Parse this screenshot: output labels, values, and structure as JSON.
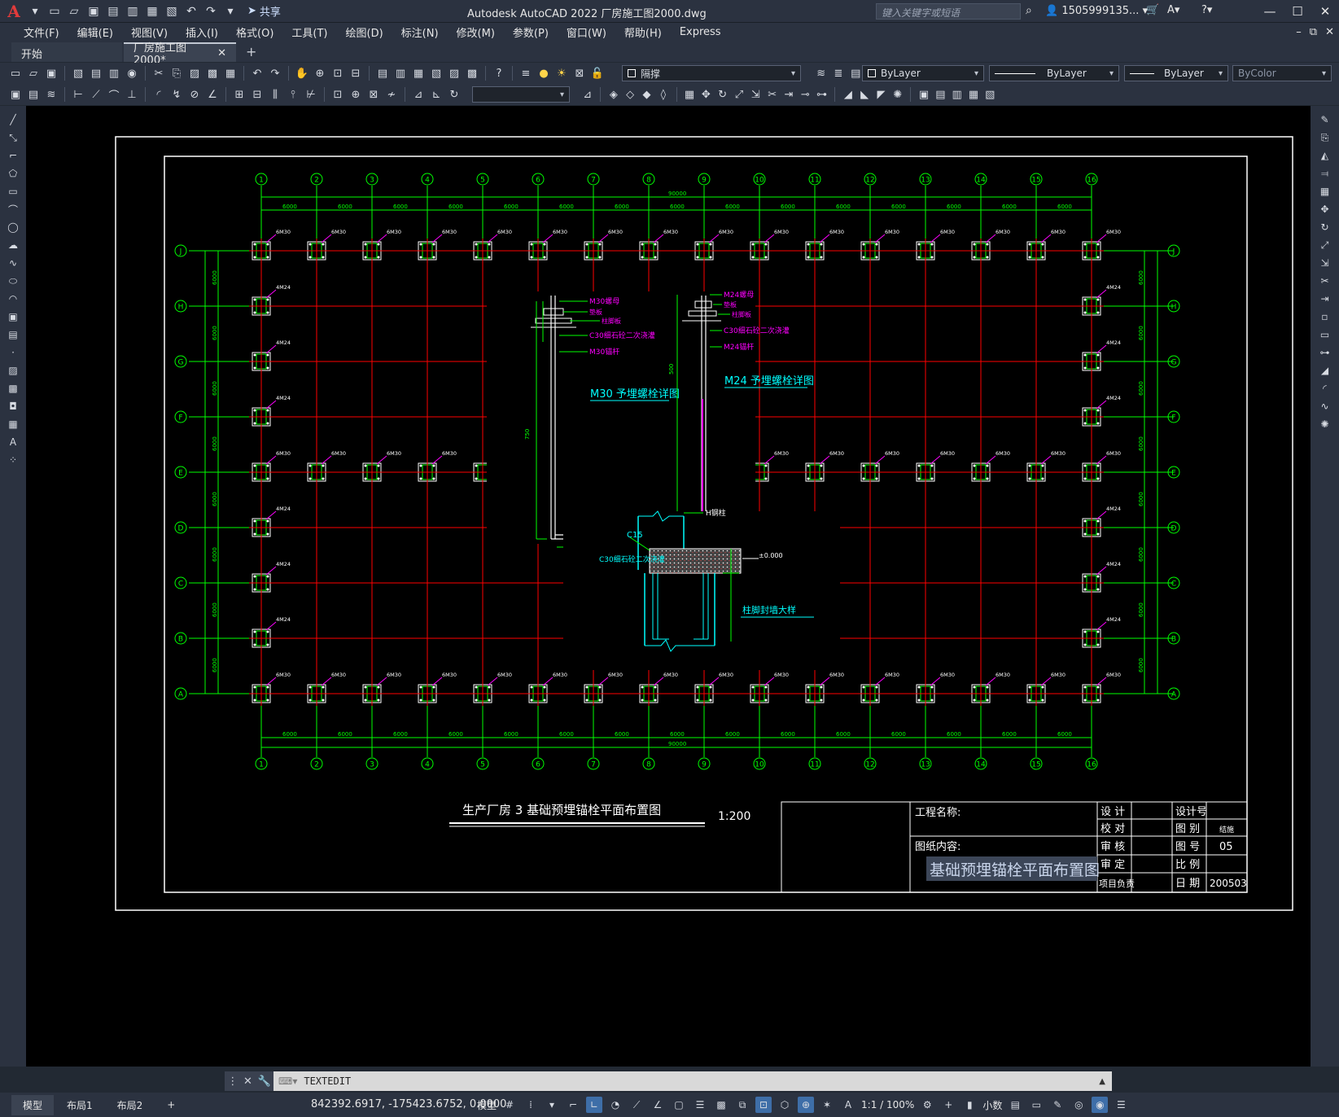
{
  "app": {
    "title": "Autodesk AutoCAD 2022    厂房施工图2000.dwg",
    "search_placeholder": "键入关键字或短语",
    "user": "1505999135... ▾",
    "share": "共享"
  },
  "menu": [
    "文件(F)",
    "编辑(E)",
    "视图(V)",
    "插入(I)",
    "格式(O)",
    "工具(T)",
    "绘图(D)",
    "标注(N)",
    "修改(M)",
    "参数(P)",
    "窗口(W)",
    "帮助(H)",
    "Express"
  ],
  "tabs": [
    {
      "label": "开始"
    },
    {
      "label": "厂房施工图2000*"
    }
  ],
  "toolbar": {
    "layer": "隔撑",
    "color": "ByLayer",
    "linetype": "ByLayer",
    "lineweight": "ByLayer",
    "plotstyle": "ByColor"
  },
  "drawing": {
    "grid_numbers": [
      "1",
      "2",
      "3",
      "4",
      "5",
      "6",
      "7",
      "8",
      "9",
      "10",
      "11",
      "12",
      "13",
      "14",
      "15",
      "16"
    ],
    "grid_letters": [
      "J",
      "H",
      "G",
      "F",
      "E",
      "D",
      "C",
      "B",
      "A"
    ],
    "span_label": "6000",
    "total_label": "90000",
    "bolt_label": "6M30",
    "bolt_label_side": "4M24",
    "detail1_title": "M30 予埋螺栓详图",
    "detail2_title": "M24 予埋螺栓详图",
    "detail3_title": "柱脚封墙大样",
    "detail1_notes": [
      "M30螺母",
      "垫板",
      "柱脚板",
      "C30细石砼二次浇灌",
      "M30锚杆"
    ],
    "detail2_notes": [
      "M24螺母",
      "垫板",
      "柱脚板",
      "C30细石砼二次浇灌",
      "M24锚杆"
    ],
    "detail3_notes": [
      "H钢柱",
      "C15",
      "C30细石砼二次浇灌",
      "±0.000"
    ],
    "drawing_title": "生产厂房 3 基础预埋锚栓平面布置图",
    "scale": "1:200",
    "titleblock": {
      "project_name": "工程名称:",
      "content": "图纸内容:",
      "content_value": "基础预埋锚栓平面布置图",
      "design": "设 计",
      "check": "校 对",
      "review": "审 核",
      "approve": "审 定",
      "pm": "项目负责",
      "design_no": "设计号",
      "category": "图 别",
      "category_value": "结施",
      "sheet_no": "图 号",
      "sheet_value": "05",
      "ratio": "比 例",
      "date": "日 期",
      "date_value": "200503"
    }
  },
  "command": {
    "text": "TEXTEDIT"
  },
  "status": {
    "layout_tabs": [
      "模型",
      "布局1",
      "布局2"
    ],
    "coords": "842392.6917, -175423.6752, 0.0000",
    "mode": "模型",
    "scale": "1:1 / 100%",
    "units": "小数"
  },
  "colors": {
    "grid_green": "#00ff00",
    "column_red": "#ff0000",
    "detail_cyan": "#00ffff",
    "label_magenta": "#ff00ff",
    "white": "#ffffff"
  }
}
